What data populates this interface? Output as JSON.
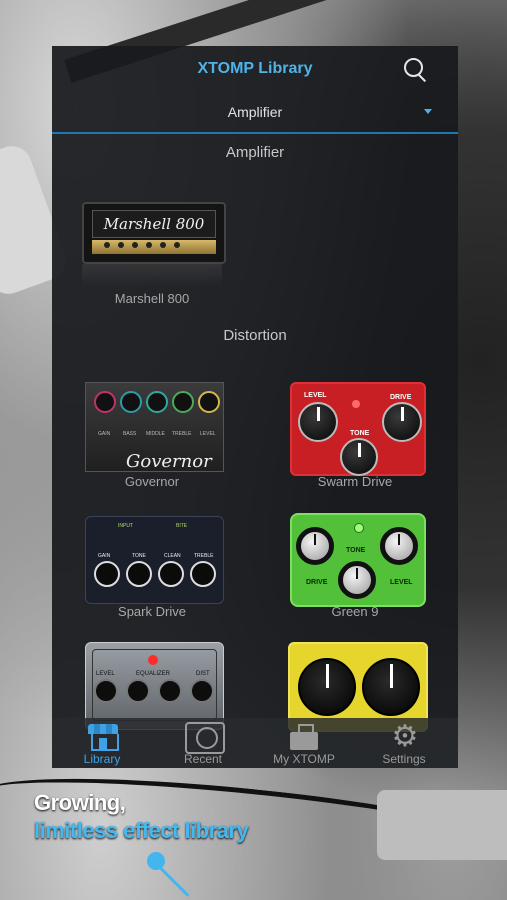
{
  "header": {
    "title": "XTOMP Library",
    "search_icon": "search-icon"
  },
  "category_select": {
    "selected": "Amplifier"
  },
  "sections": [
    {
      "title": "Amplifier",
      "items": [
        {
          "label": "Marshell 800",
          "logo_text": "Marshell 800"
        }
      ]
    },
    {
      "title": "Distortion",
      "items": [
        {
          "label": "Governor",
          "knob_labels": [
            "GAIN",
            "BASS",
            "MIDDLE",
            "TREBLE",
            "LEVEL"
          ],
          "script": "Governor"
        },
        {
          "label": "Swarm Drive",
          "knob_labels": [
            "LEVEL",
            "TONE",
            "DRIVE"
          ]
        },
        {
          "label": "Spark Drive",
          "knob_labels": [
            "GAIN",
            "TONE",
            "CLEAN",
            "TREBLE"
          ],
          "top_labels": [
            "INPUT",
            "BITE"
          ]
        },
        {
          "label": "Green 9",
          "knob_labels": [
            "DRIVE",
            "TONE",
            "LEVEL"
          ]
        },
        {
          "label": "",
          "knob_labels": [
            "LEVEL",
            "EQUALIZER",
            "DIST"
          ]
        },
        {
          "label": ""
        }
      ]
    }
  ],
  "tabs": [
    {
      "label": "Library",
      "icon": "store-icon",
      "active": true
    },
    {
      "label": "Recent",
      "icon": "vinyl-icon",
      "active": false
    },
    {
      "label": "My XTOMP",
      "icon": "pedal-icon",
      "active": false
    },
    {
      "label": "Settings",
      "icon": "gear-icon",
      "active": false
    }
  ],
  "promo": {
    "line1": "Growing,",
    "line2": "limitless effect library"
  },
  "colors": {
    "accent": "#3ea3e6",
    "panel": "#18191e"
  }
}
